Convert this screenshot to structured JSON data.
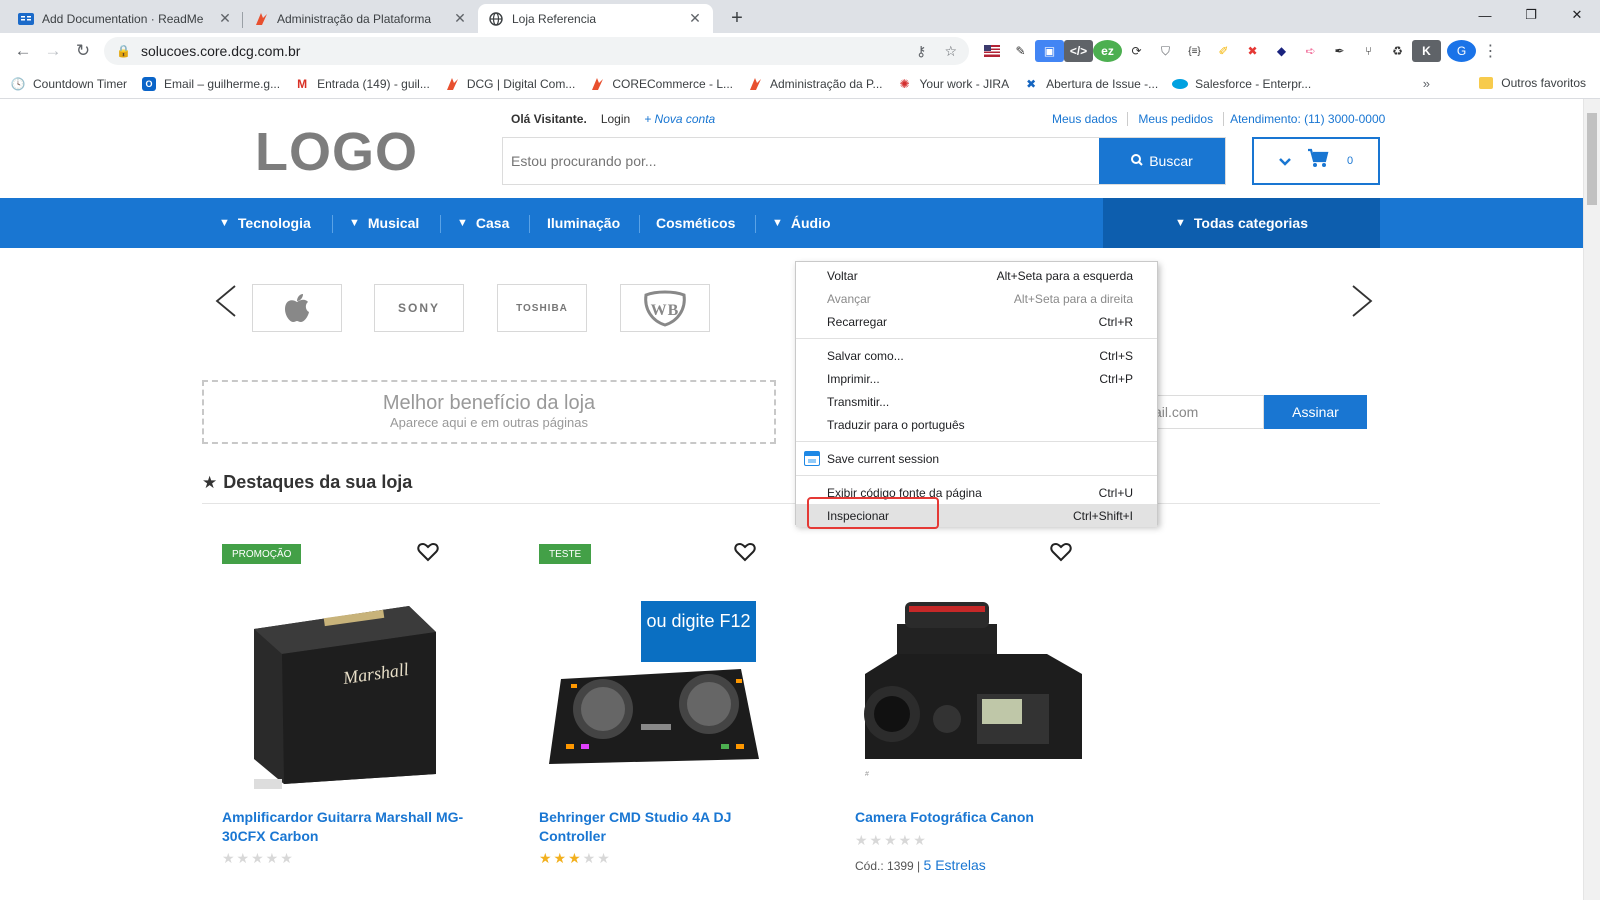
{
  "browser": {
    "tabs": [
      {
        "title": "Add Documentation · ReadMe",
        "icon": "readme-icon",
        "active": false
      },
      {
        "title": "Administração da Plataforma",
        "icon": "core-icon",
        "active": false
      },
      {
        "title": "Loja Referencia",
        "icon": "globe-icon",
        "active": true
      }
    ],
    "url": "solucoes.core.dcg.com.br",
    "bookmarks": [
      {
        "label": "Countdown Timer",
        "icon": "clock-icon"
      },
      {
        "label": "Email – guilherme.g...",
        "icon": "outlook-icon"
      },
      {
        "label": "Entrada (149) - guil...",
        "icon": "gmail-icon"
      },
      {
        "label": "DCG | Digital Com...",
        "icon": "core-icon"
      },
      {
        "label": "CORECommerce - L...",
        "icon": "core-icon"
      },
      {
        "label": "Administração da P...",
        "icon": "core-icon"
      },
      {
        "label": "Your work - JIRA",
        "icon": "jira-icon"
      },
      {
        "label": "Abertura de Issue -...",
        "icon": "jira-blue-icon"
      },
      {
        "label": "Salesforce - Enterpr...",
        "icon": "salesforce-icon"
      }
    ],
    "bookmarks_more": "»",
    "other_bookmarks": "Outros favoritos",
    "profile_initial": "G"
  },
  "store": {
    "logo": "LOGO",
    "greeting": "Olá Visitante.",
    "login": "Login",
    "new_account": "+ Nova conta",
    "top_links": [
      "Meus dados",
      "Meus pedidos",
      "Atendimento: (11) 3000-0000"
    ],
    "search_placeholder": "Estou procurando por...",
    "search_button": "Buscar",
    "cart_count": "0",
    "categories": [
      "Tecnologia",
      "Musical",
      "Casa",
      "Iluminação",
      "Cosméticos",
      "Áudio"
    ],
    "all_categories": "Todas categorias",
    "brands": [
      "apple",
      "SONY",
      "TOSHIBA",
      "WB"
    ],
    "benefit_title": "Melhor benefício da loja",
    "benefit_subtitle": "Aparece aqui e em outras páginas",
    "newsletter_partial": "ail.com",
    "newsletter_button": "Assinar",
    "section_title": "Destaques da sua loja",
    "products": [
      {
        "badge": "PROMOÇÃO",
        "name": "Amplificardor Guitarra Marshall MG-30CFX Carbon",
        "rating": 0
      },
      {
        "badge": "TESTE",
        "name": "Behringer CMD Studio 4A DJ Controller",
        "rating": 3
      },
      {
        "badge": "",
        "name": "Camera Fotográfica Canon",
        "rating": 0,
        "code": "Cód.: 1399 |",
        "rating_text": "5 Estrelas"
      }
    ],
    "callout": "ou digite F12"
  },
  "context_menu": {
    "items": [
      {
        "label": "Voltar",
        "shortcut": "Alt+Seta para a esquerda",
        "disabled": false
      },
      {
        "label": "Avançar",
        "shortcut": "Alt+Seta para a direita",
        "disabled": true
      },
      {
        "label": "Recarregar",
        "shortcut": "Ctrl+R",
        "disabled": false
      },
      {
        "label": "Salvar como...",
        "shortcut": "Ctrl+S",
        "disabled": false
      },
      {
        "label": "Imprimir...",
        "shortcut": "Ctrl+P",
        "disabled": false
      },
      {
        "label": "Transmitir...",
        "shortcut": "",
        "disabled": false
      },
      {
        "label": "Traduzir para o português",
        "shortcut": "",
        "disabled": false
      },
      {
        "label": "Save current session",
        "shortcut": "",
        "disabled": false
      },
      {
        "label": "Exibir código fonte da página",
        "shortcut": "Ctrl+U",
        "disabled": false
      },
      {
        "label": "Inspecionar",
        "shortcut": "Ctrl+Shift+I",
        "disabled": false,
        "highlighted": true
      }
    ]
  },
  "colors": {
    "brand_blue": "#1976d2",
    "nav_dark": "#0d5eae",
    "badge_green": "#43a047",
    "highlight_red": "#e53935",
    "callout_blue": "#0a6fc2"
  }
}
